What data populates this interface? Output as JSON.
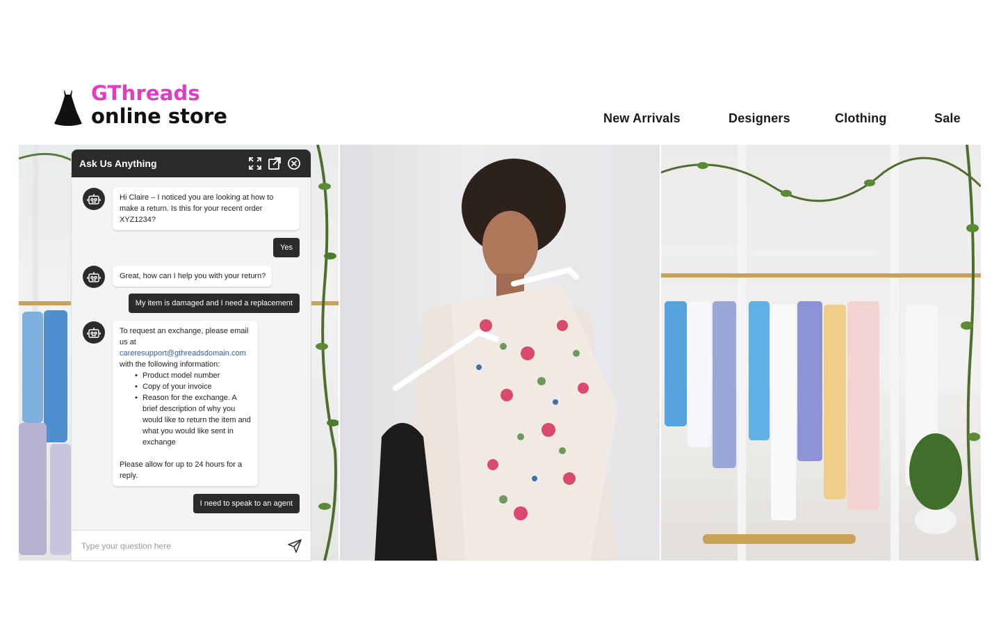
{
  "brand": {
    "name": "GThreads",
    "tagline": "online store",
    "accent_color": "#e03cc8",
    "logo_icon": "dress-icon"
  },
  "nav": {
    "items": [
      {
        "label": "New Arrivals"
      },
      {
        "label": "Designers"
      },
      {
        "label": "Clothing"
      },
      {
        "label": "Sale"
      }
    ]
  },
  "hero": {
    "images": [
      {
        "description_icon": "clothing-rack-photo"
      },
      {
        "description_icon": "woman-holding-dress-photo"
      },
      {
        "description_icon": "boutique-interior-photo"
      }
    ]
  },
  "chat": {
    "title": "Ask Us Anything",
    "header_icons": [
      "expand-icon",
      "popout-icon",
      "close-icon"
    ],
    "bot_avatar_icon": "robot-icon",
    "messages": [
      {
        "from": "bot",
        "text": "Hi Claire – I noticed you are looking at how to make a return. Is this for your recent order XYZ1234?"
      },
      {
        "from": "user",
        "text": "Yes"
      },
      {
        "from": "bot",
        "text": "Great, how can I help you with your return?"
      },
      {
        "from": "user",
        "text": "My item is damaged and I need a replacement"
      },
      {
        "from": "bot",
        "intro": "To request an exchange, please email us at",
        "email": "careresupport@gthreadsdomain.com",
        "lead": "with the following information:",
        "list": [
          "Product model number",
          "Copy of your invoice",
          "Reason for the exchange. A brief description of why you would like to return the item and what you would like sent in exchange"
        ],
        "footer": "Please allow for up to 24 hours for a reply."
      },
      {
        "from": "user",
        "text": "I need to speak to an agent"
      }
    ],
    "input": {
      "value": "",
      "placeholder": "Type your question here",
      "send_icon": "send-icon"
    }
  }
}
